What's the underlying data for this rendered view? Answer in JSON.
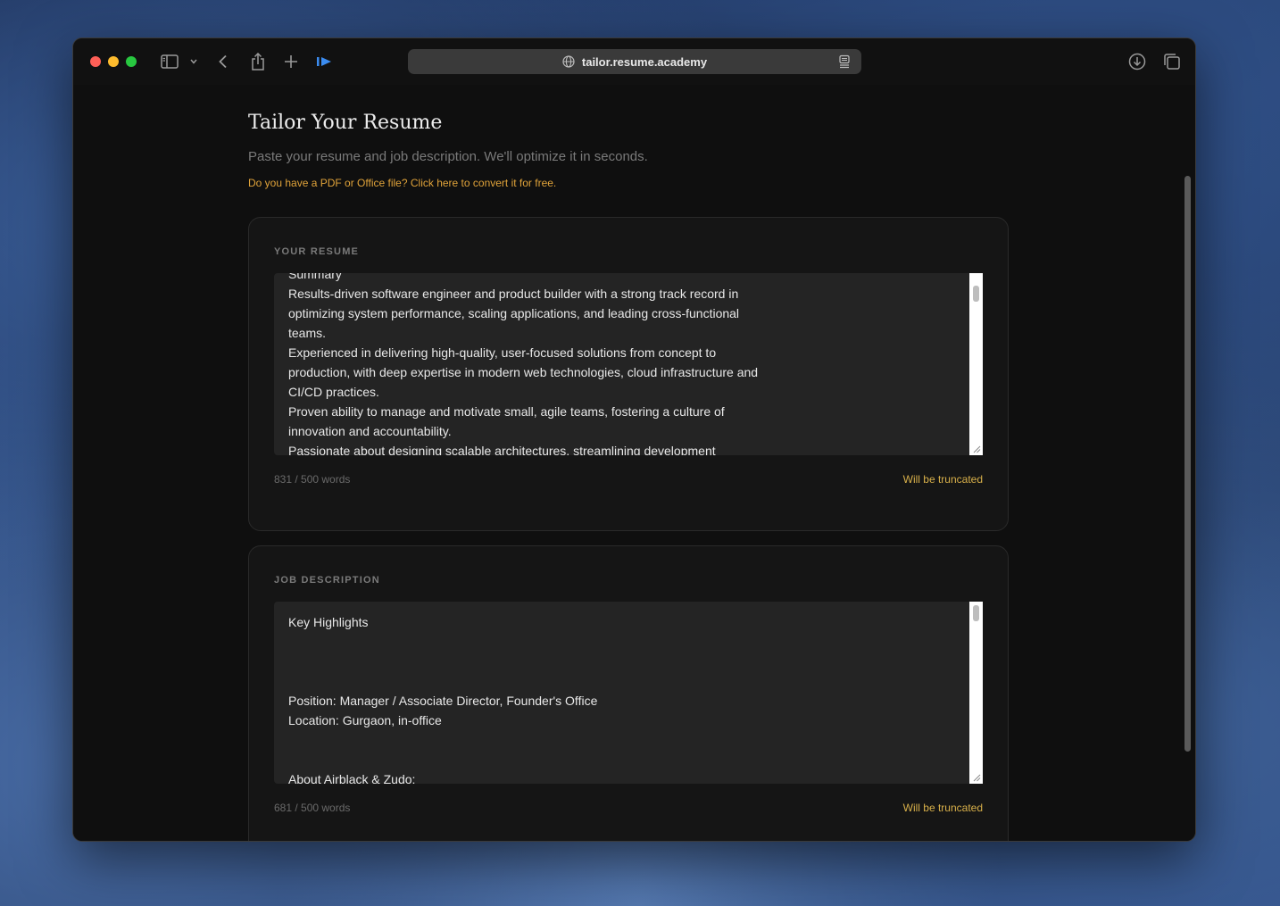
{
  "browser": {
    "url": "tailor.resume.academy"
  },
  "page": {
    "title": "Tailor Your Resume",
    "subtitle": "Paste your resume and job description. We'll optimize it in seconds.",
    "convert_link": "Do you have a PDF or Office file? Click here to convert it for free."
  },
  "resume": {
    "label": "YOUR RESUME",
    "lines": [
      "Summary",
      "Results-driven software engineer and product builder with a strong track record in",
      "optimizing system performance, scaling applications, and leading cross-functional",
      "teams.",
      "Experienced in delivering high-quality, user-focused solutions from concept to",
      "production, with deep expertise in modern web technologies, cloud infrastructure and",
      "CI/CD practices.",
      "Proven ability to manage and motivate small, agile teams, fostering a culture of",
      "innovation and accountability.",
      "Passionate about designing scalable architectures, streamlining development"
    ],
    "word_count": "831 / 500 words",
    "status": "Will be truncated"
  },
  "job": {
    "label": "JOB DESCRIPTION",
    "lines": [
      "Key Highlights",
      "",
      "",
      "",
      "Position: Manager / Associate Director, Founder's Office",
      "Location: Gurgaon, in-office",
      "",
      "",
      "About Airblack & Zudo:"
    ],
    "word_count": "681 / 500 words",
    "status": "Will be truncated"
  },
  "icons": [
    "sidebar-icon",
    "chevron-down-icon",
    "back-icon",
    "share-icon",
    "new-tab-icon",
    "extension-icon",
    "globe-icon",
    "reader-icon",
    "download-icon",
    "tabs-overview-icon"
  ],
  "colors": {
    "accent": "#e0a33a",
    "warning": "#d8b04a",
    "background": "#0f0f0f",
    "card": "#151515",
    "textarea": "#242424"
  }
}
